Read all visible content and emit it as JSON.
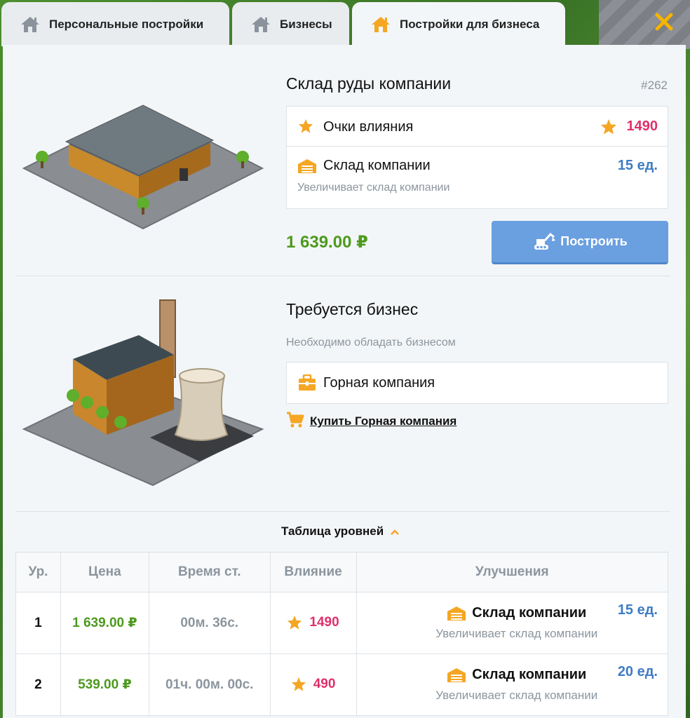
{
  "tabs": [
    {
      "label": "Персональные постройки"
    },
    {
      "label": "Бизнесы"
    },
    {
      "label": "Постройки для бизнеса"
    }
  ],
  "building": {
    "title": "Склад руды компании",
    "id": "#262",
    "influence_label": "Очки влияния",
    "influence_value": "1490",
    "storage_label": "Склад компании",
    "storage_value": "15 ед.",
    "storage_desc": "Увеличивает склад компании",
    "price": "1 639.00 ₽",
    "build_button": "Построить"
  },
  "requirement": {
    "title": "Требуется бизнес",
    "desc": "Необходимо обладать бизнесом",
    "business": "Горная компания",
    "buy_link": "Купить Горная компания"
  },
  "levels": {
    "title": "Таблица уровней",
    "headers": [
      "Ур.",
      "Цена",
      "Время ст.",
      "Влияние",
      "Улучшения"
    ],
    "rows": [
      {
        "level": "1",
        "price": "1 639.00 ₽",
        "time": "00м. 36с.",
        "influence": "1490",
        "upgrade": "Склад компании",
        "upgrade_desc": "Увеличивает склад компании",
        "upgrade_value": "15 ед."
      },
      {
        "level": "2",
        "price": "539.00 ₽",
        "time": "01ч. 00м. 00с.",
        "influence": "490",
        "upgrade": "Склад компании",
        "upgrade_desc": "Увеличивает склад компании",
        "upgrade_value": "20 ед."
      }
    ]
  },
  "colors": {
    "accent": "#f5a623",
    "green": "#4d9a1e",
    "blue": "#3e7cc4",
    "pink": "#e0306a",
    "button": "#6a9fe0"
  }
}
